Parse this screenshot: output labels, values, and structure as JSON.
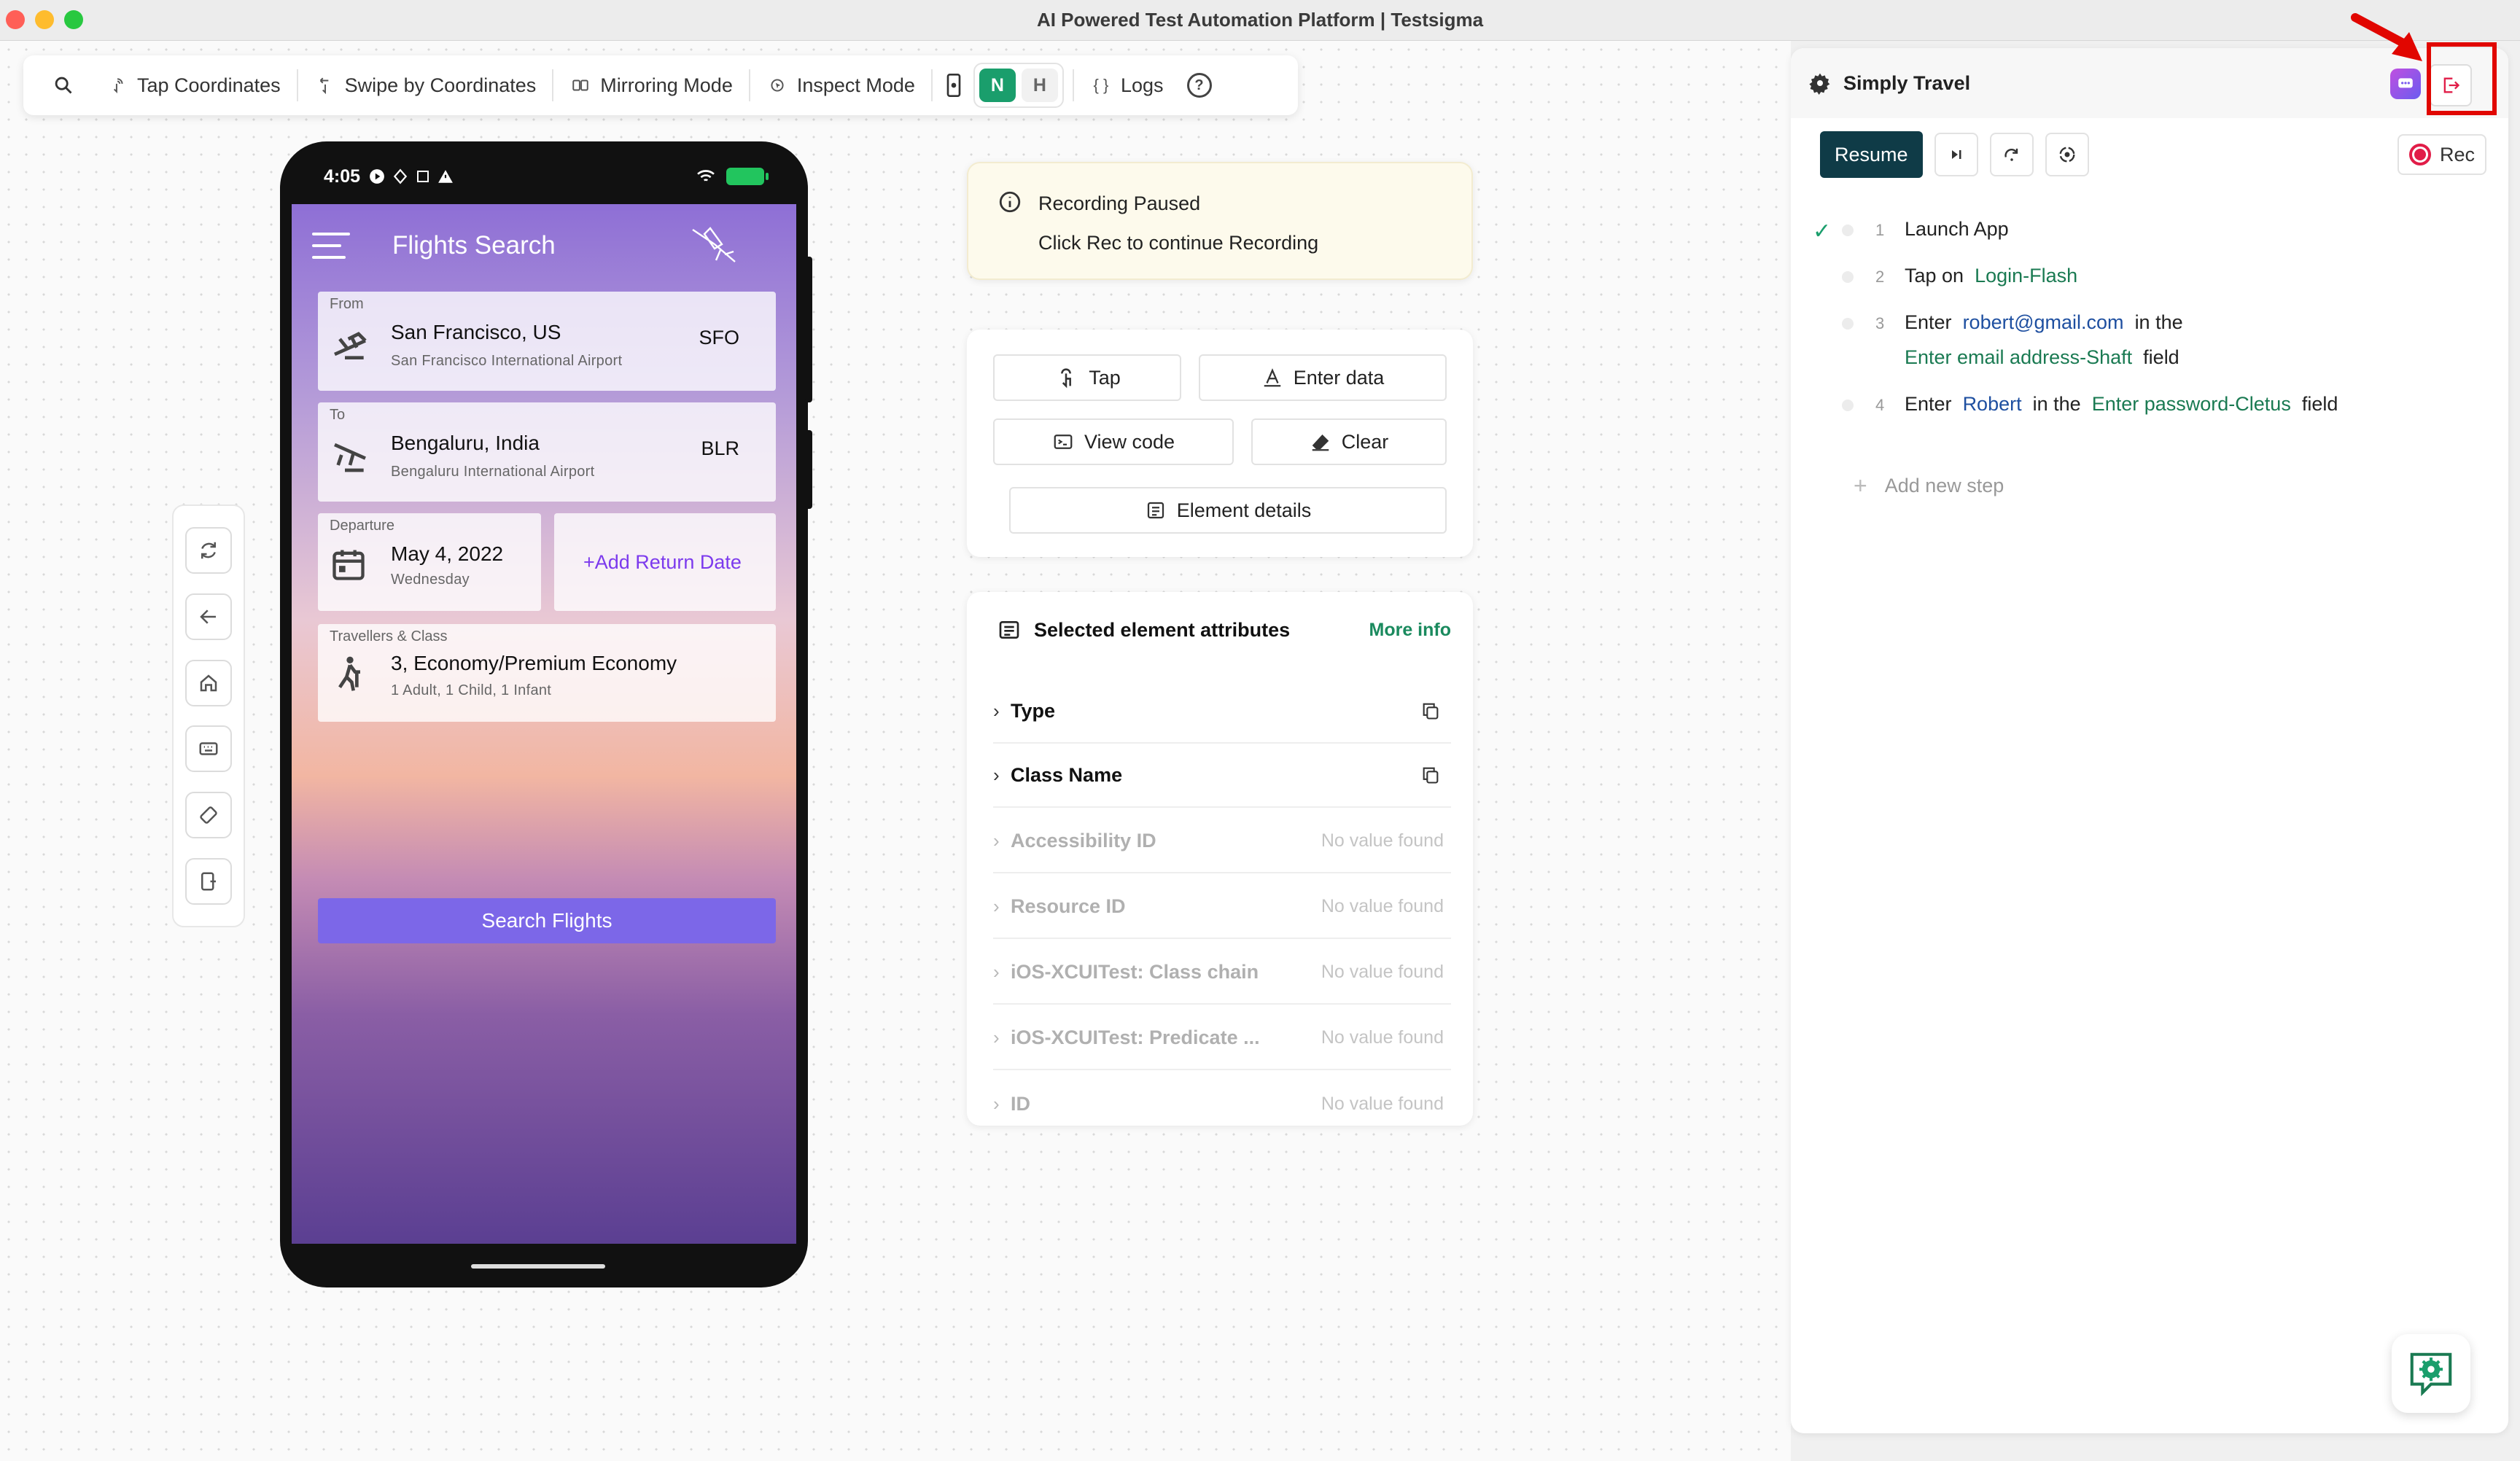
{
  "window": {
    "title": "AI Powered Test Automation Platform | Testsigma"
  },
  "toolbar": {
    "tap_coordinates": "Tap Coordinates",
    "swipe_by_coordinates": "Swipe by Coordinates",
    "mirroring_mode": "Mirroring Mode",
    "inspect_mode": "Inspect Mode",
    "n_label": "N",
    "h_label": "H",
    "logs": "Logs",
    "help": "?"
  },
  "phone": {
    "status_time": "4:05",
    "app_title": "Flights Search",
    "from": {
      "label": "From",
      "city": "San Francisco, US",
      "airport": "San Francisco International Airport",
      "code": "SFO"
    },
    "to": {
      "label": "To",
      "city": "Bengaluru, India",
      "airport": "Bengaluru International Airport",
      "code": "BLR"
    },
    "departure": {
      "label": "Departure",
      "date": "May 4, 2022",
      "day": "Wednesday"
    },
    "add_return": "+Add Return Date",
    "travellers": {
      "label": "Travellers & Class",
      "value": "3, Economy/Premium Economy",
      "detail": "1 Adult, 1 Child, 1 Infant"
    },
    "search_button": "Search Flights"
  },
  "recording": {
    "title": "Recording Paused",
    "subtitle": "Click Rec to continue Recording"
  },
  "actions": {
    "tap": "Tap",
    "enter_data": "Enter data",
    "view_code": "View code",
    "clear": "Clear",
    "element_details": "Element details"
  },
  "attributes": {
    "title": "Selected element attributes",
    "more_info": "More info",
    "rows": [
      {
        "name": "Type",
        "value": ""
      },
      {
        "name": "Class Name",
        "value": ""
      },
      {
        "name": "Accessibility ID",
        "value": "No value found"
      },
      {
        "name": "Resource ID",
        "value": "No value found"
      },
      {
        "name": "iOS-XCUITest: Class chain",
        "value": "No value found"
      },
      {
        "name": "iOS-XCUITest: Predicate ...",
        "value": "No value found"
      },
      {
        "name": "ID",
        "value": "No value found"
      }
    ]
  },
  "recorder": {
    "project_name": "Simply Travel",
    "resume": "Resume",
    "rec": "Rec",
    "steps": [
      {
        "num": "1",
        "text": "Launch App"
      },
      {
        "num": "2",
        "prefix": "Tap on",
        "element": "Login-Flash"
      },
      {
        "num": "3",
        "prefix": "Enter",
        "value": "robert@gmail.com",
        "mid": "in the",
        "element": "Enter email address-Shaft",
        "suffix": "field"
      },
      {
        "num": "4",
        "prefix": "Enter",
        "value": "Robert",
        "mid": "in the",
        "element": "Enter password-Cletus",
        "suffix": "field"
      }
    ],
    "add_step": "Add new step"
  },
  "colors": {
    "accent_green": "#1a9e6c",
    "resume_bg": "#0f3b47",
    "highlight_red": "#e10600",
    "search_button": "#7c67e8"
  }
}
